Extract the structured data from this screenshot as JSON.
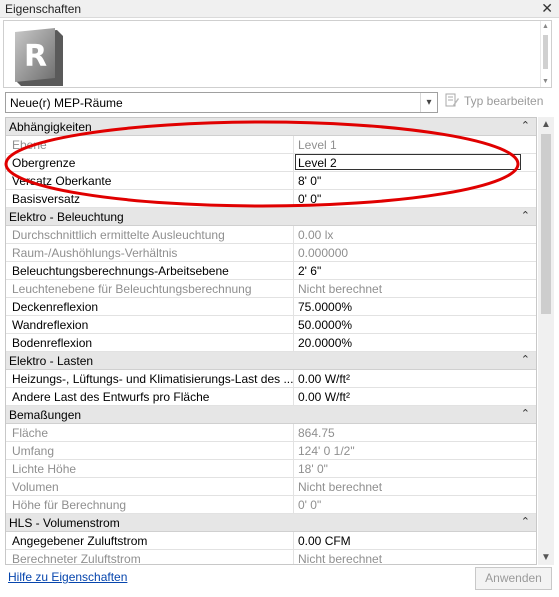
{
  "window": {
    "title": "Eigenschaften",
    "close_glyph": "✕"
  },
  "type_selector": {
    "value": "Neue(r) MEP-Räume",
    "edit_type_label": "Typ bearbeiten"
  },
  "categories": [
    {
      "name": "Abhängigkeiten",
      "rows": [
        {
          "name": "Ebene",
          "value": "Level 1",
          "readonly": true
        },
        {
          "name": "Obergrenze",
          "value": "Level 2",
          "readonly": false,
          "editing": true
        },
        {
          "name": "Versatz Oberkante",
          "value": "8'  0\"",
          "readonly": false
        },
        {
          "name": "Basisversatz",
          "value": "0'  0\"",
          "readonly": false
        }
      ]
    },
    {
      "name": "Elektro - Beleuchtung",
      "rows": [
        {
          "name": "Durchschnittlich ermittelte Ausleuchtung",
          "value": "0.00 lx",
          "readonly": true
        },
        {
          "name": "Raum-/Aushöhlungs-Verhältnis",
          "value": "0.000000",
          "readonly": true
        },
        {
          "name": "Beleuchtungsberechnungs-Arbeitsebene",
          "value": "2'  6\"",
          "readonly": false
        },
        {
          "name": "Leuchtenebene für Beleuchtungsberechnung",
          "value": "Nicht berechnet",
          "readonly": true
        },
        {
          "name": "Deckenreflexion",
          "value": "75.0000%",
          "readonly": false
        },
        {
          "name": "Wandreflexion",
          "value": "50.0000%",
          "readonly": false
        },
        {
          "name": "Bodenreflexion",
          "value": "20.0000%",
          "readonly": false
        }
      ]
    },
    {
      "name": "Elektro - Lasten",
      "rows": [
        {
          "name": "Heizungs-, Lüftungs- und Klimatisierungs-Last des ...",
          "value": "0.00 W/ft²",
          "readonly": false
        },
        {
          "name": "Andere Last des Entwurfs pro Fläche",
          "value": "0.00 W/ft²",
          "readonly": false
        }
      ]
    },
    {
      "name": "Bemaßungen",
      "rows": [
        {
          "name": "Fläche",
          "value": "864.75",
          "readonly": true
        },
        {
          "name": "Umfang",
          "value": "124'  0 1/2\"",
          "readonly": true
        },
        {
          "name": "Lichte Höhe",
          "value": "18'  0\"",
          "readonly": true
        },
        {
          "name": "Volumen",
          "value": "Nicht berechnet",
          "readonly": true
        },
        {
          "name": "Höhe für Berechnung",
          "value": "0'  0\"",
          "readonly": true
        }
      ]
    },
    {
      "name": "HLS - Volumenstrom",
      "rows": [
        {
          "name": "Angegebener Zuluftstrom",
          "value": "0.00 CFM",
          "readonly": false
        },
        {
          "name": "Berechneter Zuluftstrom",
          "value": "Nicht berechnet",
          "readonly": true
        }
      ]
    }
  ],
  "collapse_glyph": "⌃",
  "footer": {
    "help_link": "Hilfe zu Eigenschaften",
    "apply_button": "Anwenden"
  },
  "colors": {
    "annotation": "#e00000",
    "link": "#0645ad",
    "category_bg": "#e6e6e6"
  },
  "icons": {
    "revit": "revit-logo-icon",
    "edit_type": "edit-type-icon"
  }
}
